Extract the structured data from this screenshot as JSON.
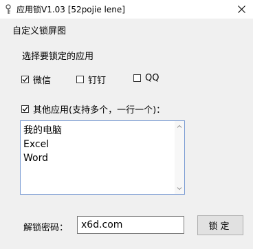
{
  "window": {
    "title": "应用锁V1.03 [52pojie lene]",
    "icon": "lock-key-icon",
    "close_symbol": "✕"
  },
  "menu": {
    "items": [
      {
        "label": "自定义锁屏图"
      }
    ]
  },
  "apps_section": {
    "label": "选择要锁定的应用",
    "options": [
      {
        "label": "微信",
        "checked": true
      },
      {
        "label": "钉钉",
        "checked": false
      },
      {
        "label": "QQ",
        "checked": false
      }
    ],
    "other": {
      "label": "其他应用(支持多个，一行一个)：",
      "checked": true
    },
    "other_apps": {
      "lines": [
        "我的电脑",
        "Excel",
        "Word"
      ]
    }
  },
  "password": {
    "label": "解锁密码：",
    "value": "x6d.com"
  },
  "lock_button": {
    "label": "锁定"
  },
  "colors": {
    "titlebar_bg": "#ffffff",
    "window_bg": "#f0f0f0",
    "textarea_border": "#7a9cd3",
    "button_bg": "#e1e1e1"
  }
}
